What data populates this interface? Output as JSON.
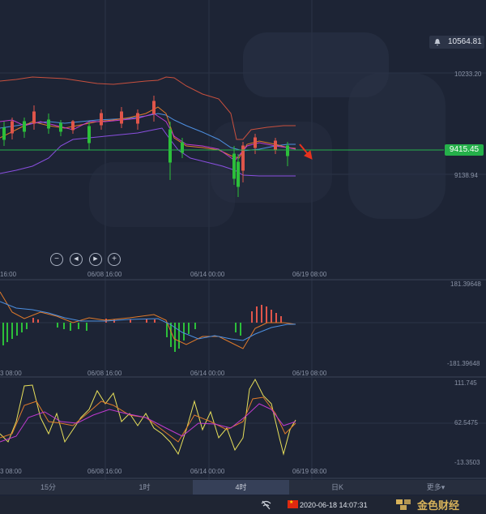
{
  "price_axis": {
    "alert_value": "10564.81",
    "upper_label": "10233.20",
    "current_price": "9415.45",
    "lower_label": "9138.94"
  },
  "macd_axis": {
    "top": "181.39648",
    "bottom": "-181.39648"
  },
  "kdj_axis": {
    "top": "111.745",
    "mid": "62.5475",
    "bottom": "-13.3503"
  },
  "time_axis": {
    "main": [
      "16:00",
      "06/08 16:00",
      "06/14 00:00",
      "06/19 08:00"
    ],
    "macd": [
      "3 08:00",
      "06/08 16:00",
      "06/14 00:00",
      "06/19 08:00"
    ],
    "kdj": [
      "3 08:00",
      "06/08 16:00",
      "06/14 00:00",
      "06/19 08:00"
    ]
  },
  "controls": {
    "zoom_out": "−",
    "prev": "◀",
    "next": "▶",
    "zoom_in": "+"
  },
  "tabs": [
    {
      "label": "15分",
      "active": false
    },
    {
      "label": "1时",
      "active": false
    },
    {
      "label": "4时",
      "active": true
    },
    {
      "label": "日K",
      "active": false
    },
    {
      "label": "更多▾",
      "active": false
    }
  ],
  "status": {
    "timestamp": "2020-06-18 14:07:31",
    "brand": "金色财经"
  },
  "colors": {
    "background": "#1d2435",
    "up": "#e0554a",
    "down": "#2cbf3a",
    "price_line": "#25b04a",
    "boll_upper": "#c8503e",
    "boll_mid": "#4d8fe0",
    "boll_lower": "#8a4fe0",
    "kdj_k": "#e8e05a",
    "kdj_d": "#e07a2a",
    "kdj_j": "#c03ad0"
  }
}
